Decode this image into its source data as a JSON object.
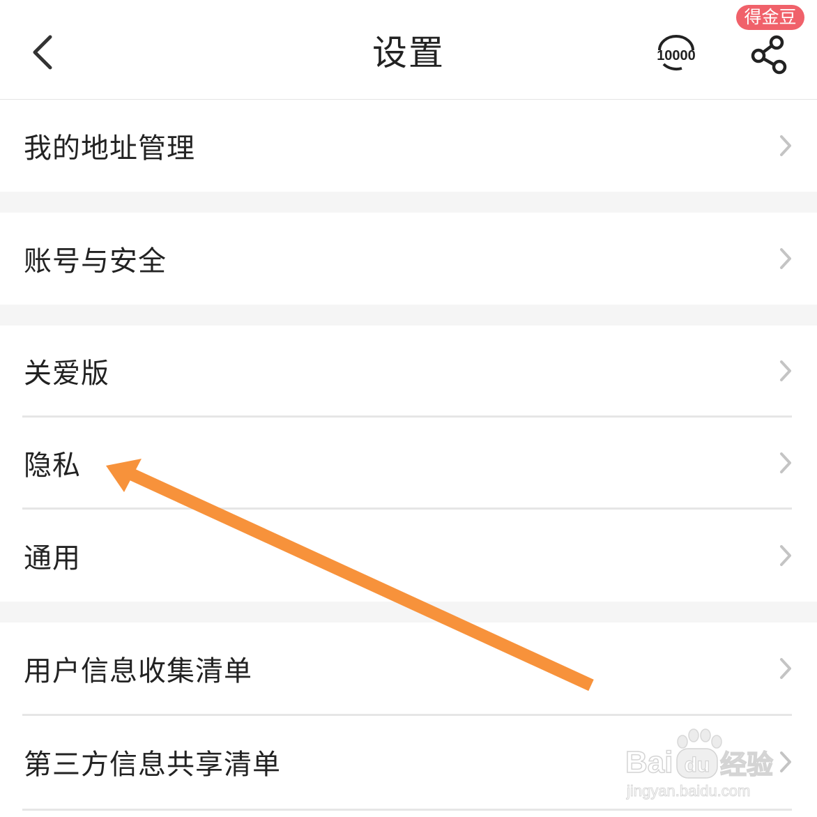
{
  "header": {
    "title": "设置",
    "back_icon": "chevron-left-icon",
    "service_icon": "customer-service-10000-icon",
    "service_text": "10000",
    "share_icon": "share-icon",
    "coin_badge": "得金豆",
    "badge_color": "#f0616a"
  },
  "sections": [
    {
      "items": [
        {
          "label": "我的地址管理"
        }
      ]
    },
    {
      "items": [
        {
          "label": "账号与安全"
        }
      ]
    },
    {
      "items": [
        {
          "label": "关爱版"
        },
        {
          "label": "隐私"
        },
        {
          "label": "通用"
        }
      ]
    },
    {
      "items": [
        {
          "label": "用户信息收集清单"
        },
        {
          "label": "第三方信息共享清单"
        }
      ]
    }
  ],
  "row_chevron_icon": "chevron-right-icon",
  "annotation": {
    "type": "arrow",
    "color": "#f7923b",
    "points_to": "隐私"
  },
  "watermark": {
    "brand": "Bai",
    "brand_icon": "paw-icon",
    "brand_du": "du",
    "product": "经验",
    "url": "jingyan.baidu.com"
  }
}
